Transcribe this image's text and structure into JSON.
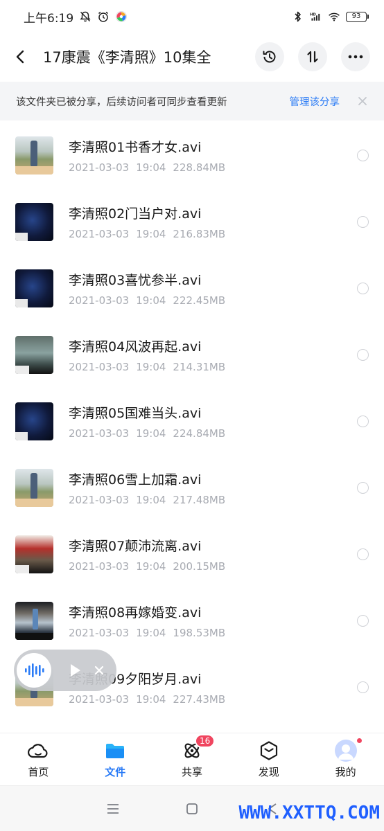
{
  "status_bar": {
    "time": "上午6:19",
    "battery": "93"
  },
  "header": {
    "title": "17康震《李清照》10集全"
  },
  "banner": {
    "text": "该文件夹已被分享，后续访问者可同步查看更新",
    "link": "管理该分享"
  },
  "files": [
    {
      "name": "李清照01书香才女.avi",
      "date": "2021-03-03",
      "time": "19:04",
      "size": "228.84MB",
      "thumb": "t-a"
    },
    {
      "name": "李清照02门当户对.avi",
      "date": "2021-03-03",
      "time": "19:04",
      "size": "216.83MB",
      "thumb": "t-b"
    },
    {
      "name": "李清照03喜忧参半.avi",
      "date": "2021-03-03",
      "time": "19:04",
      "size": "222.45MB",
      "thumb": "t-b"
    },
    {
      "name": "李清照04风波再起.avi",
      "date": "2021-03-03",
      "time": "19:04",
      "size": "214.31MB",
      "thumb": "t-c"
    },
    {
      "name": "李清照05国难当头.avi",
      "date": "2021-03-03",
      "time": "19:04",
      "size": "224.84MB",
      "thumb": "t-b"
    },
    {
      "name": "李清照06雪上加霜.avi",
      "date": "2021-03-03",
      "time": "19:04",
      "size": "217.48MB",
      "thumb": "t-a"
    },
    {
      "name": "李清照07颠沛流离.avi",
      "date": "2021-03-03",
      "time": "19:04",
      "size": "200.15MB",
      "thumb": "t-d"
    },
    {
      "name": "李清照08再嫁婚变.avi",
      "date": "2021-03-03",
      "time": "19:04",
      "size": "198.53MB",
      "thumb": "t-e"
    },
    {
      "name": "李清照09夕阳岁月.avi",
      "date": "2021-03-03",
      "time": "19:04",
      "size": "227.43MB",
      "thumb": "t-a"
    }
  ],
  "bottom_nav": {
    "items": [
      {
        "label": "首页",
        "icon": "cloud-icon"
      },
      {
        "label": "文件",
        "icon": "folder-icon"
      },
      {
        "label": "共享",
        "icon": "share-orbit-icon",
        "badge": "16"
      },
      {
        "label": "发现",
        "icon": "discover-box-icon"
      },
      {
        "label": "我的",
        "icon": "avatar-icon"
      }
    ]
  },
  "watermark": "WWW.XXTTQ.COM",
  "colors": {
    "accent": "#2a7bf6",
    "badge": "#f0455f",
    "meta_text": "#a8abb2"
  }
}
